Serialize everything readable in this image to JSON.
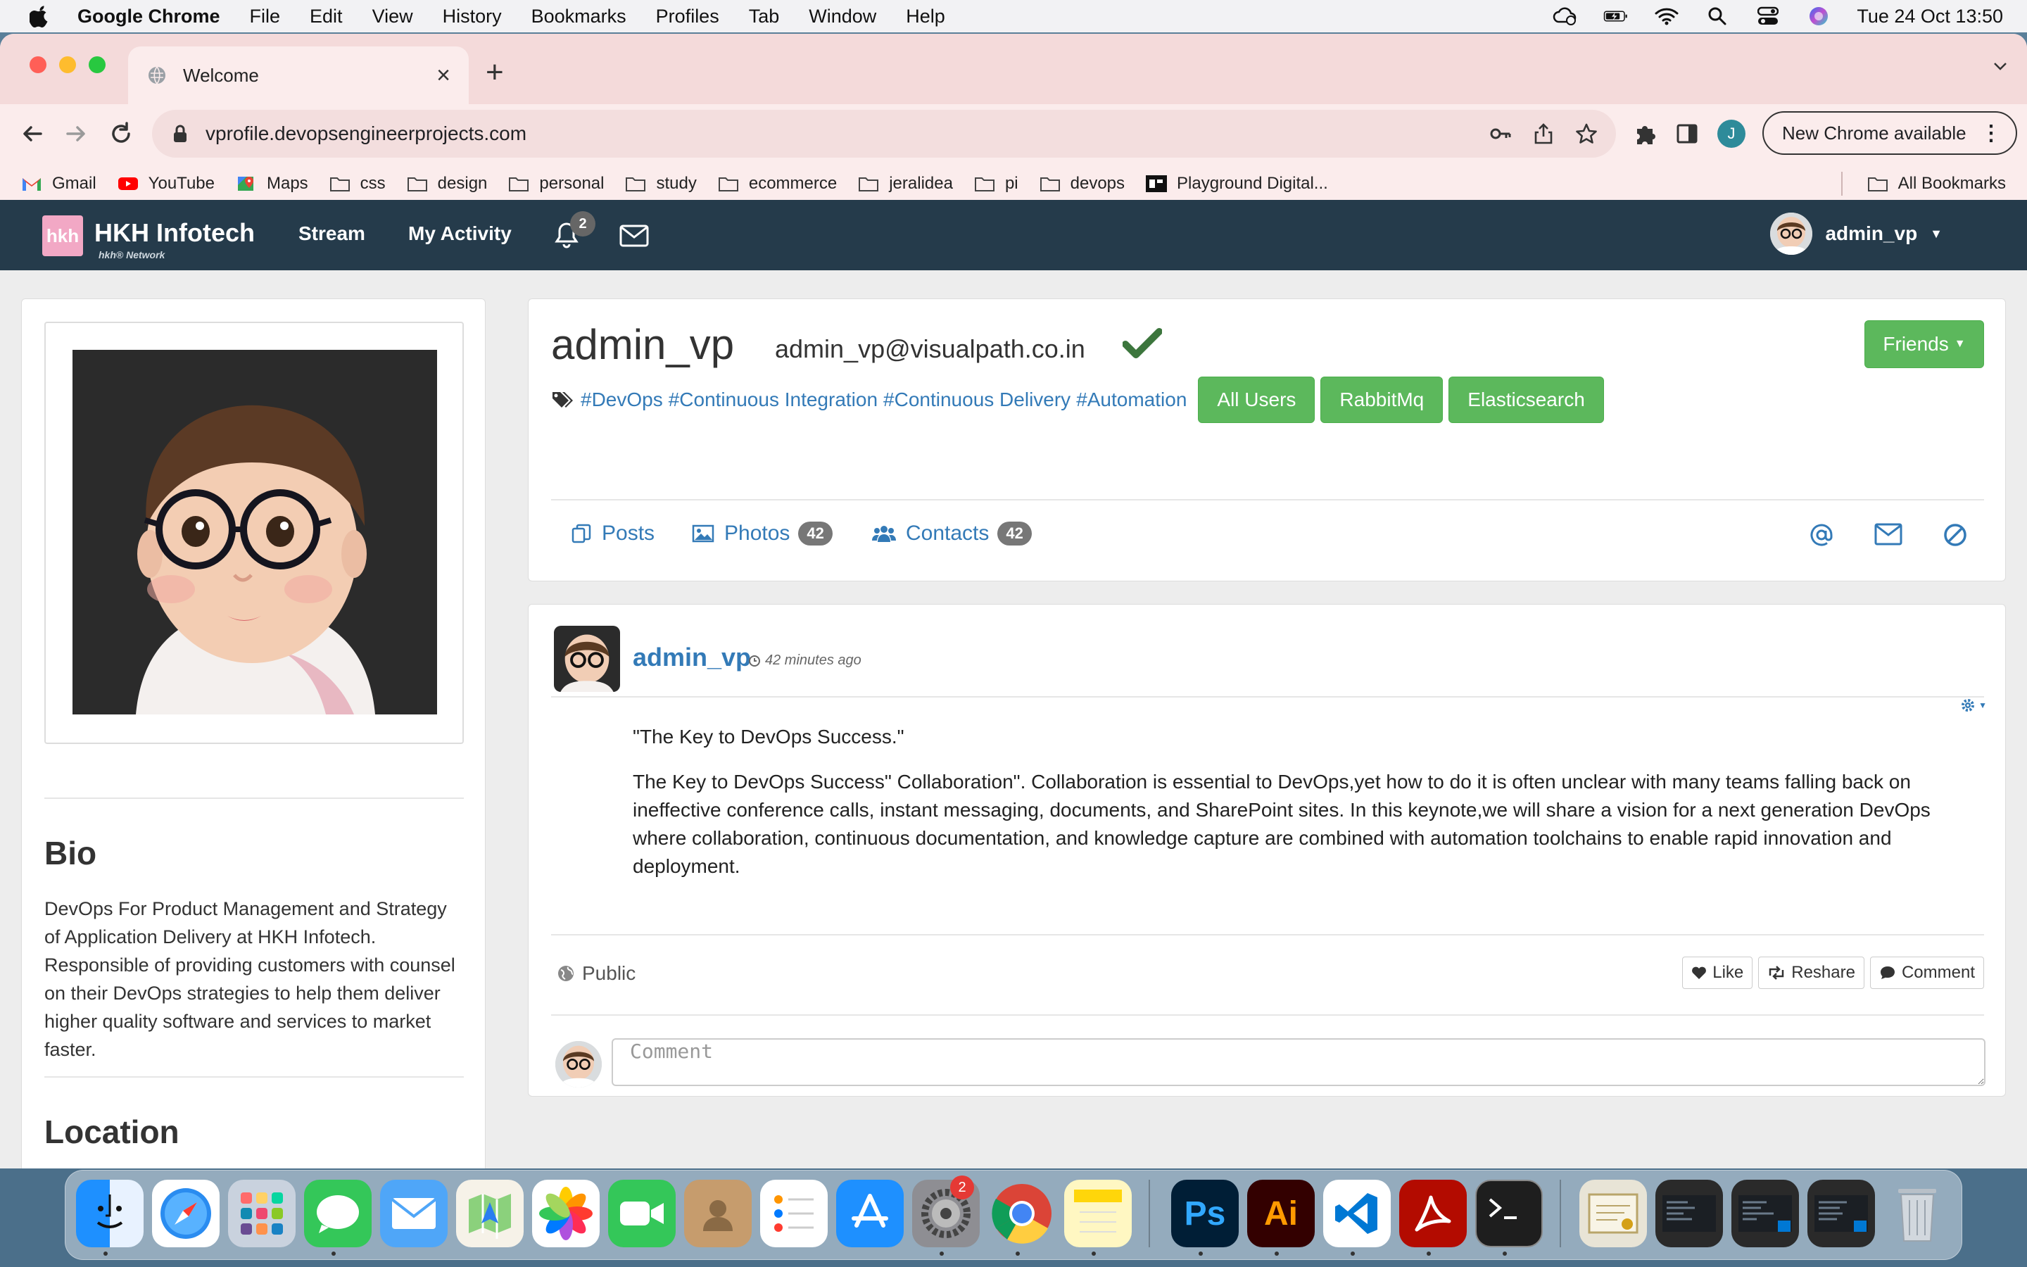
{
  "menubar": {
    "app_name": "Google Chrome",
    "items": [
      "File",
      "Edit",
      "View",
      "History",
      "Bookmarks",
      "Profiles",
      "Tab",
      "Window",
      "Help"
    ],
    "clock": "Tue 24 Oct  13:50"
  },
  "browser": {
    "tab_title": "Welcome",
    "url": "vprofile.devopsengineerprojects.com",
    "profile_initial": "J",
    "update_label": "New Chrome available",
    "bookmarks": [
      "Gmail",
      "YouTube",
      "Maps",
      "css",
      "design",
      "personal",
      "study",
      "ecommerce",
      "jeralidea",
      "pi",
      "devops",
      "Playground Digital..."
    ],
    "all_bookmarks": "All Bookmarks"
  },
  "appnav": {
    "brand": "HKH Infotech",
    "brand_sub": "hkh® Network",
    "logo_text": "hkh",
    "links": [
      "Stream",
      "My Activity"
    ],
    "notification_count": "2",
    "username": "admin_vp"
  },
  "profile": {
    "name": "admin_vp",
    "email": "admin_vp@visualpath.co.in",
    "friends_label": "Friends",
    "tags": [
      "#DevOps",
      "#Continuous Integration",
      "#Continuous Delivery",
      "#Automation"
    ],
    "buttons": [
      "All Users",
      "RabbitMq",
      "Elasticsearch"
    ],
    "tabs": {
      "posts": "Posts",
      "photos": "Photos",
      "photos_count": "42",
      "contacts": "Contacts",
      "contacts_count": "42"
    }
  },
  "sidebar": {
    "bio_title": "Bio",
    "bio_text": "DevOps For Product Management and Strategy of Application Delivery at HKH Infotech. Responsible of providing customers with counsel on their DevOps strategies to help them deliver higher quality software and services to market faster.",
    "location_title": "Location"
  },
  "post": {
    "author": "admin_vp",
    "time": "42 minutes ago",
    "title": "\"The Key to DevOps Success.\"",
    "body": "The Key to DevOps Success\" Collaboration\". Collaboration is essential to DevOps,yet how to do it is often unclear with many teams falling back on ineffective conference calls, instant messaging, documents, and SharePoint sites. In this keynote,we will share a vision for a next generation DevOps where collaboration, continuous documentation, and knowledge capture are combined with automation toolchains to enable rapid innovation and deployment.",
    "visibility": "Public",
    "like": "Like",
    "reshare": "Reshare",
    "comment": "Comment",
    "comment_placeholder": "Comment"
  },
  "dock": {
    "settings_badge": "2",
    "apps": [
      "Finder",
      "Safari",
      "Launchpad",
      "Messages",
      "Mail",
      "Maps",
      "Photos",
      "FaceTime",
      "Contacts",
      "Reminders",
      "App Store",
      "System Settings",
      "Chrome",
      "Notes",
      "Ps",
      "Ai",
      "VS Code",
      "Acrobat",
      "Terminal",
      "Downloads",
      "Trash"
    ]
  },
  "colors": {
    "navbar": "#253b4b",
    "link": "#337ab7",
    "success": "#5cb85c",
    "tabstrip": "#f4dada"
  }
}
